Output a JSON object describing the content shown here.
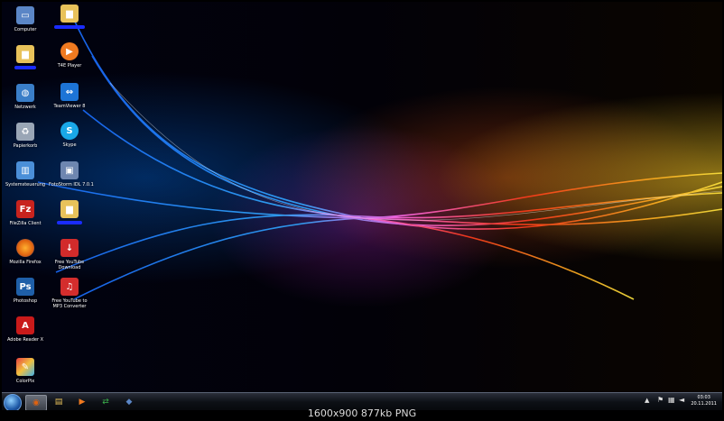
{
  "desktop": {
    "icons": [
      {
        "label": "Computer",
        "icon": "computer-icon",
        "color": "#5b86c6"
      },
      {
        "label": "",
        "icon": "folder-icon",
        "color": "#e8c25a",
        "redacted": true
      },
      {
        "label": "",
        "icon": "folder-icon",
        "color": "#e8c25a",
        "redacted": true
      },
      {
        "label": "T4E Player",
        "icon": "player-icon",
        "color": "#f07a20"
      },
      {
        "label": "Netzwerk",
        "icon": "network-icon",
        "color": "#3a7ec8"
      },
      {
        "label": "TeamViewer 8",
        "icon": "teamviewer-icon",
        "color": "#1d74d6"
      },
      {
        "label": "Papierkorb",
        "icon": "recycle-bin-icon",
        "color": "#9aa6b6"
      },
      {
        "label": "Skype",
        "icon": "skype-icon",
        "color": "#19a8e8"
      },
      {
        "label": "Systemsteuerung",
        "icon": "control-panel-icon",
        "color": "#4b8fd8"
      },
      {
        "label": "FotoStorm IDL 7.0.1",
        "icon": "box-icon",
        "color": "#6e86b0"
      },
      {
        "label": "FileZilla Client",
        "icon": "filezilla-icon",
        "color": "#c8231e"
      },
      {
        "label": "",
        "icon": "folder-icon",
        "color": "#e8c25a",
        "redacted": true
      },
      {
        "label": "Mozilla Firefox",
        "icon": "firefox-icon",
        "color": "#e0620f"
      },
      {
        "label": "Free YouTube Download",
        "icon": "download-icon",
        "color": "#d22b2b"
      },
      {
        "label": "Photoshop",
        "icon": "photoshop-icon",
        "color": "#1f5fa8"
      },
      {
        "label": "Free YouTube to MP3 Converter",
        "icon": "mp3-converter-icon",
        "color": "#d42d2d"
      },
      {
        "label": "Adobe Reader X",
        "icon": "adobe-reader-icon",
        "color": "#c91a1a"
      },
      {
        "label": "ColorPix",
        "icon": "colorpix-icon",
        "color": "#7a9fd0"
      }
    ]
  },
  "taskbar": {
    "buttons": [
      {
        "icon": "firefox-icon",
        "glyph": "◉",
        "color": "#e0620f",
        "active": true
      },
      {
        "icon": "folder-icon",
        "glyph": "▤",
        "color": "#e8c25a",
        "active": false
      },
      {
        "icon": "media-player-icon",
        "glyph": "▶",
        "color": "#f07a20",
        "active": false
      },
      {
        "icon": "network-sharing-icon",
        "glyph": "⇄",
        "color": "#3ab04a",
        "active": false
      },
      {
        "icon": "app-icon",
        "glyph": "◆",
        "color": "#5b86c6",
        "active": false
      }
    ],
    "clock_time": "03:03",
    "clock_date": "20.11.2011"
  },
  "caption": "1600x900  877kb  PNG"
}
